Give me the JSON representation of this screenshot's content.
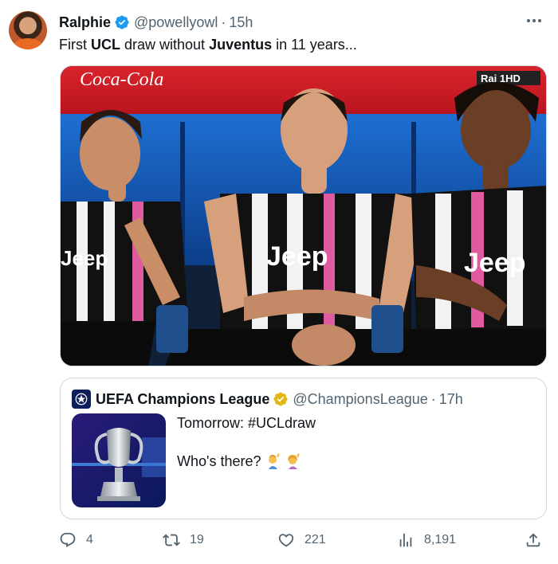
{
  "author": {
    "display_name": "Ralphie",
    "handle": "@powellyowl",
    "separator": "·",
    "time": "15h",
    "verified": true
  },
  "tweet_text": {
    "part1": "First ",
    "bold1": "UCL",
    "part2": " draw without ",
    "bold2": "Juventus",
    "part3": " in 11 years..."
  },
  "media": {
    "sponsor_logo": "Coca-Cola",
    "broadcaster_logo": "Rai 1HD",
    "jersey_text": "Jeep"
  },
  "quote": {
    "display_name": "UEFA Champions League",
    "handle": "@ChampionsLeague",
    "separator": "·",
    "time": "17h",
    "line1": "Tomorrow: #UCLdraw",
    "line2": "Who's there?"
  },
  "actions": {
    "replies": "4",
    "retweets": "19",
    "likes": "221",
    "views": "8,191"
  },
  "colors": {
    "verified_blue": "#1d9bf0",
    "verified_gold": "#e2b719",
    "secondary_text": "#536471",
    "border": "#cfd9de"
  },
  "icons": [
    "verified-badge-icon",
    "more-icon",
    "reply-icon",
    "retweet-icon",
    "like-icon",
    "views-icon",
    "share-icon"
  ]
}
